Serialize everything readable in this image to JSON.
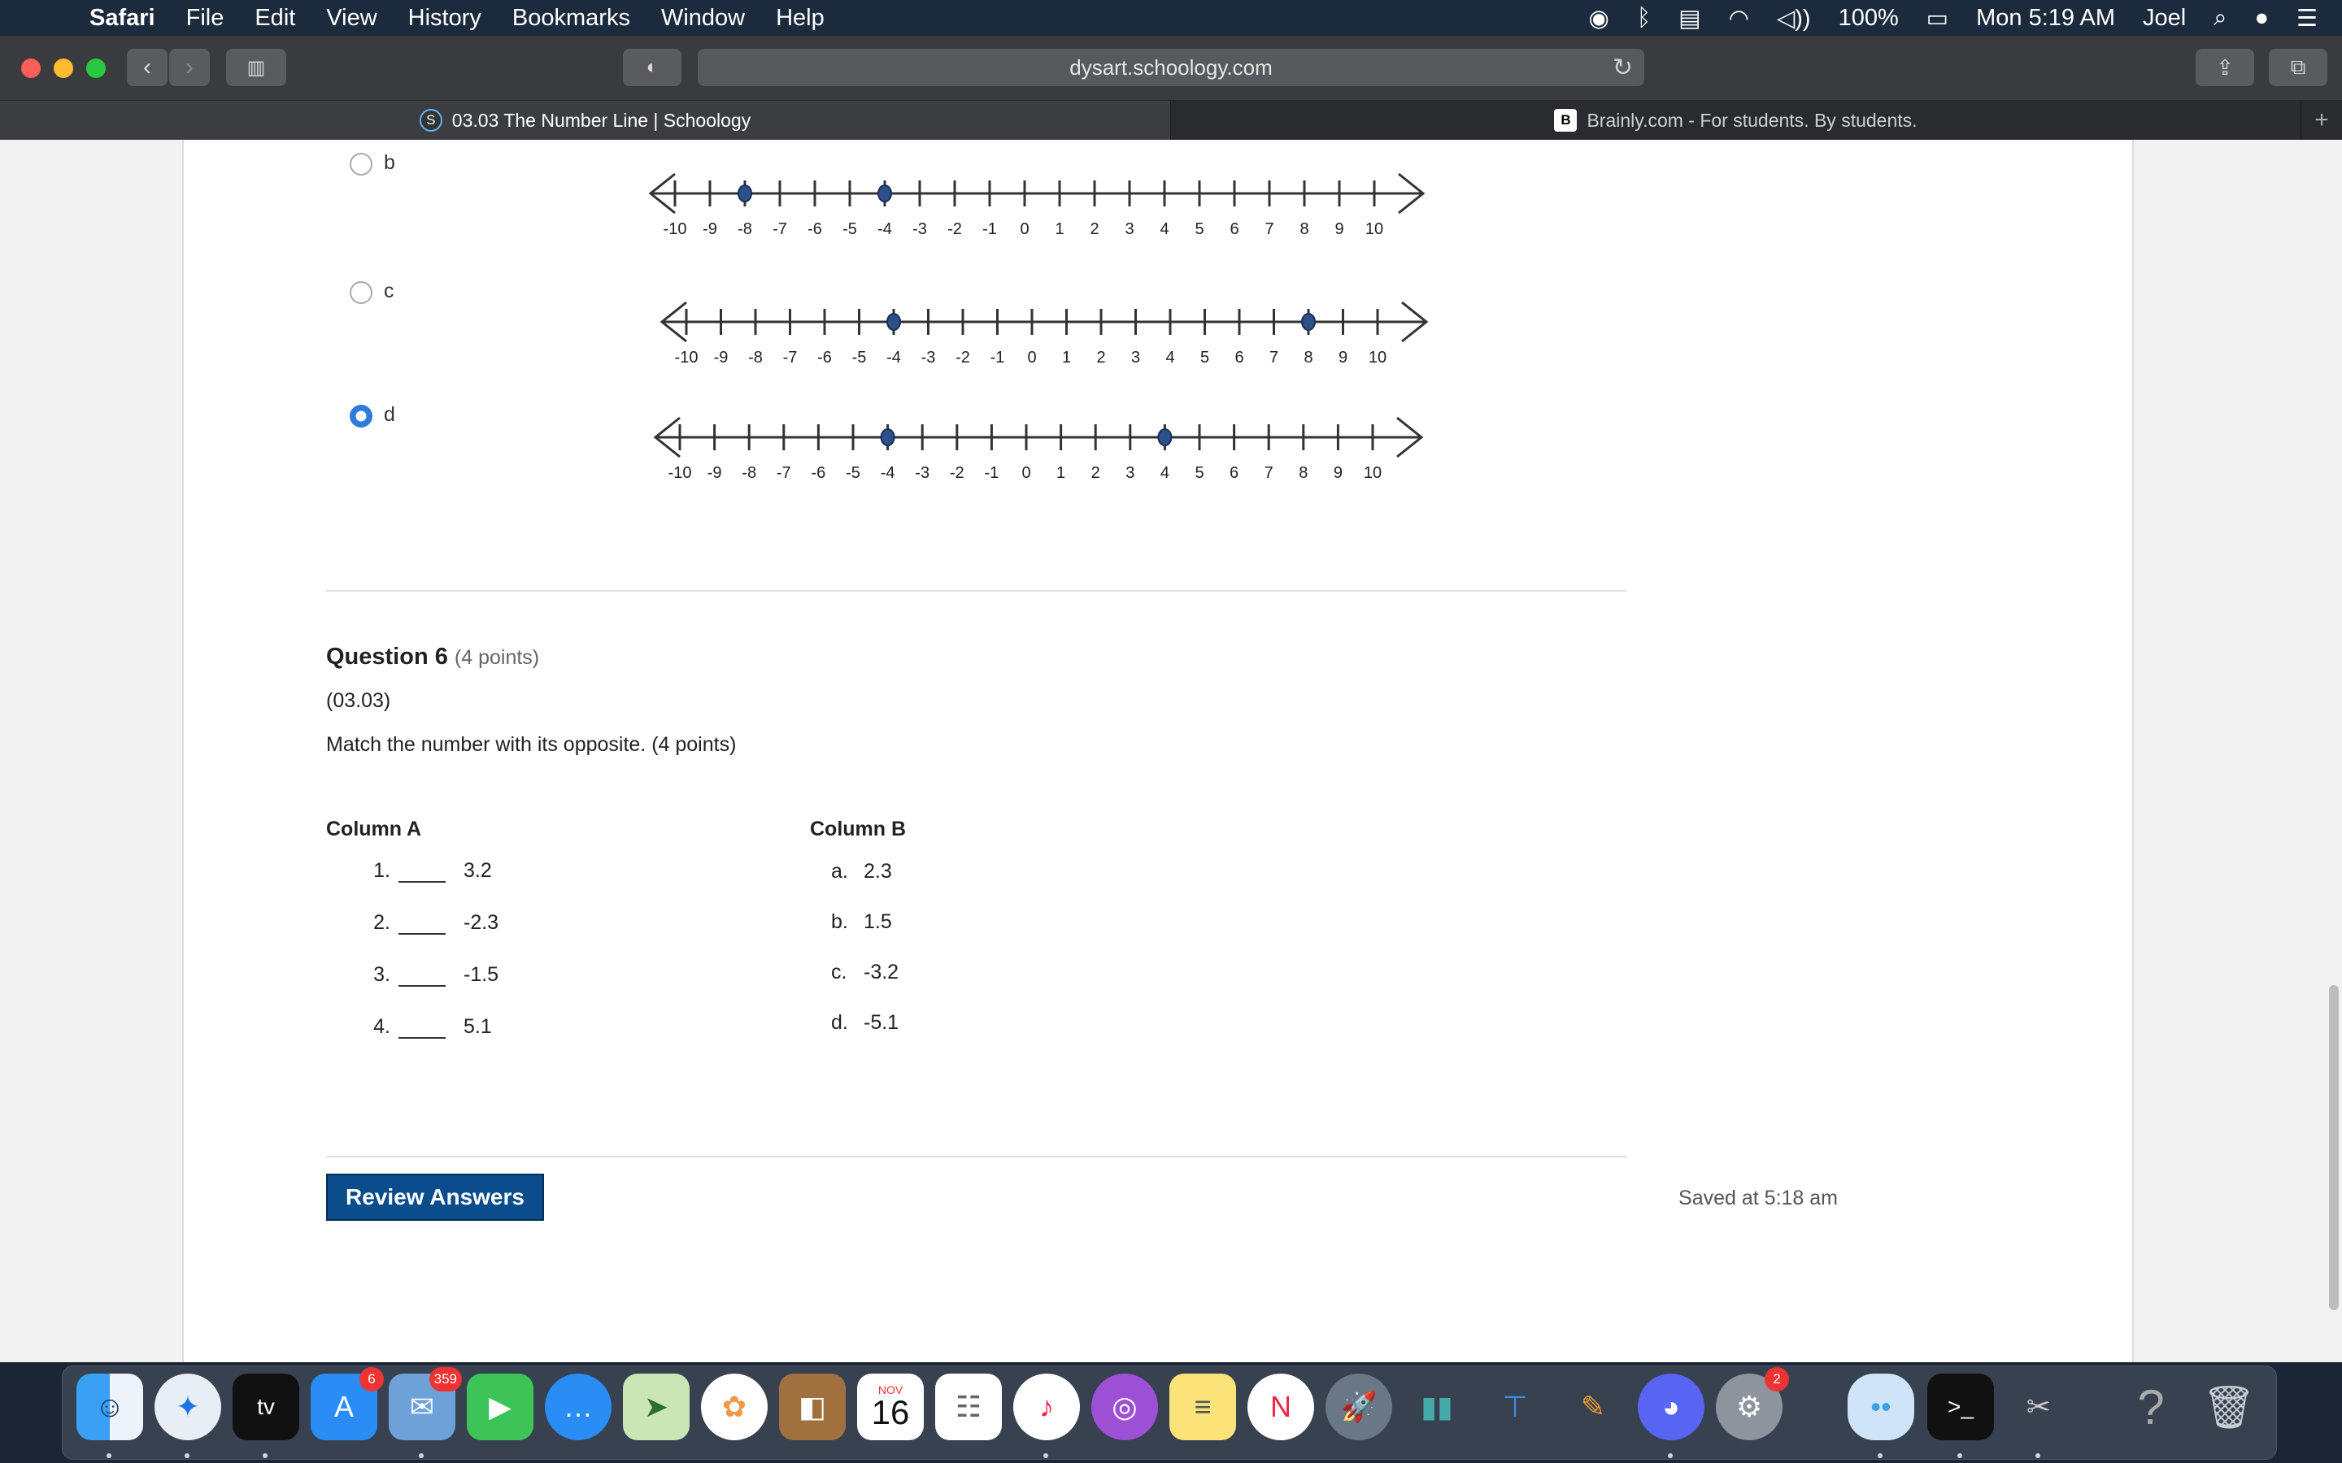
{
  "menubar": {
    "app": "Safari",
    "items": [
      "File",
      "Edit",
      "View",
      "History",
      "Bookmarks",
      "Window",
      "Help"
    ],
    "battery": "100%",
    "clock": "Mon 5:19 AM",
    "user": "Joel"
  },
  "browser": {
    "url": "dysart.schoology.com",
    "tabs": [
      {
        "title": "03.03 The Number Line | Schoology",
        "favicon": "S"
      },
      {
        "title": "Brainly.com - For students. By students.",
        "favicon": "B"
      }
    ]
  },
  "options": [
    {
      "letter": "b",
      "selected": false,
      "points": [
        -8,
        -4
      ]
    },
    {
      "letter": "c",
      "selected": false,
      "points": [
        -4,
        8
      ]
    },
    {
      "letter": "d",
      "selected": true,
      "points": [
        -4,
        4
      ]
    }
  ],
  "numberline": {
    "ticks": [
      "-10",
      "-9",
      "-8",
      "-7",
      "-6",
      "-5",
      "-4",
      "-3",
      "-2",
      "-1",
      "0",
      "1",
      "2",
      "3",
      "4",
      "5",
      "6",
      "7",
      "8",
      "9",
      "10"
    ]
  },
  "question": {
    "title": "Question 6",
    "points": "(4 points)",
    "code": "(03.03)",
    "text": "Match the number with its opposite. (4 points)",
    "column_a_title": "Column A",
    "column_b_title": "Column B",
    "column_a": [
      {
        "num": "1.",
        "value": "3.2"
      },
      {
        "num": "2.",
        "value": "-2.3"
      },
      {
        "num": "3.",
        "value": "-1.5"
      },
      {
        "num": "4.",
        "value": "5.1"
      }
    ],
    "column_b": [
      {
        "letter": "a.",
        "value": "2.3"
      },
      {
        "letter": "b.",
        "value": "1.5"
      },
      {
        "letter": "c.",
        "value": "-3.2"
      },
      {
        "letter": "d.",
        "value": "-5.1"
      }
    ]
  },
  "footer": {
    "review_label": "Review Answers",
    "saved_text": "Saved at 5:18 am"
  },
  "dock": {
    "badges": {
      "appstore": "6",
      "mail": "359",
      "calendar_month": "NOV",
      "calendar_day": "16",
      "settings": "2"
    }
  }
}
